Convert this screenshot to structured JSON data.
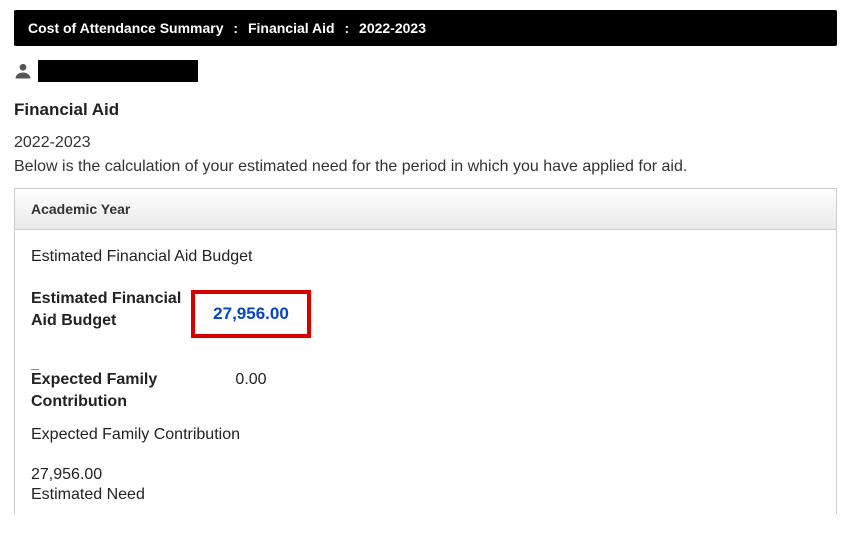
{
  "breadcrumb": {
    "part1": "Cost of Attendance Summary",
    "part2": "Financial Aid",
    "part3": "2022-2023"
  },
  "section_title": "Financial Aid",
  "year": "2022-2023",
  "description": "Below is the calculation of your estimated need for the period in which you have applied for aid.",
  "panel": {
    "header": "Academic Year",
    "subhead": "Estimated Financial Aid Budget",
    "budget_label": "Estimated Financial Aid Budget",
    "budget_value": "27,956.00",
    "sep": "_",
    "efc_label": "Expected Family Contribution",
    "efc_value": "0.00",
    "efc_plain": "Expected Family Contribution",
    "need_value": "27,956.00",
    "need_label": "Estimated Need"
  }
}
